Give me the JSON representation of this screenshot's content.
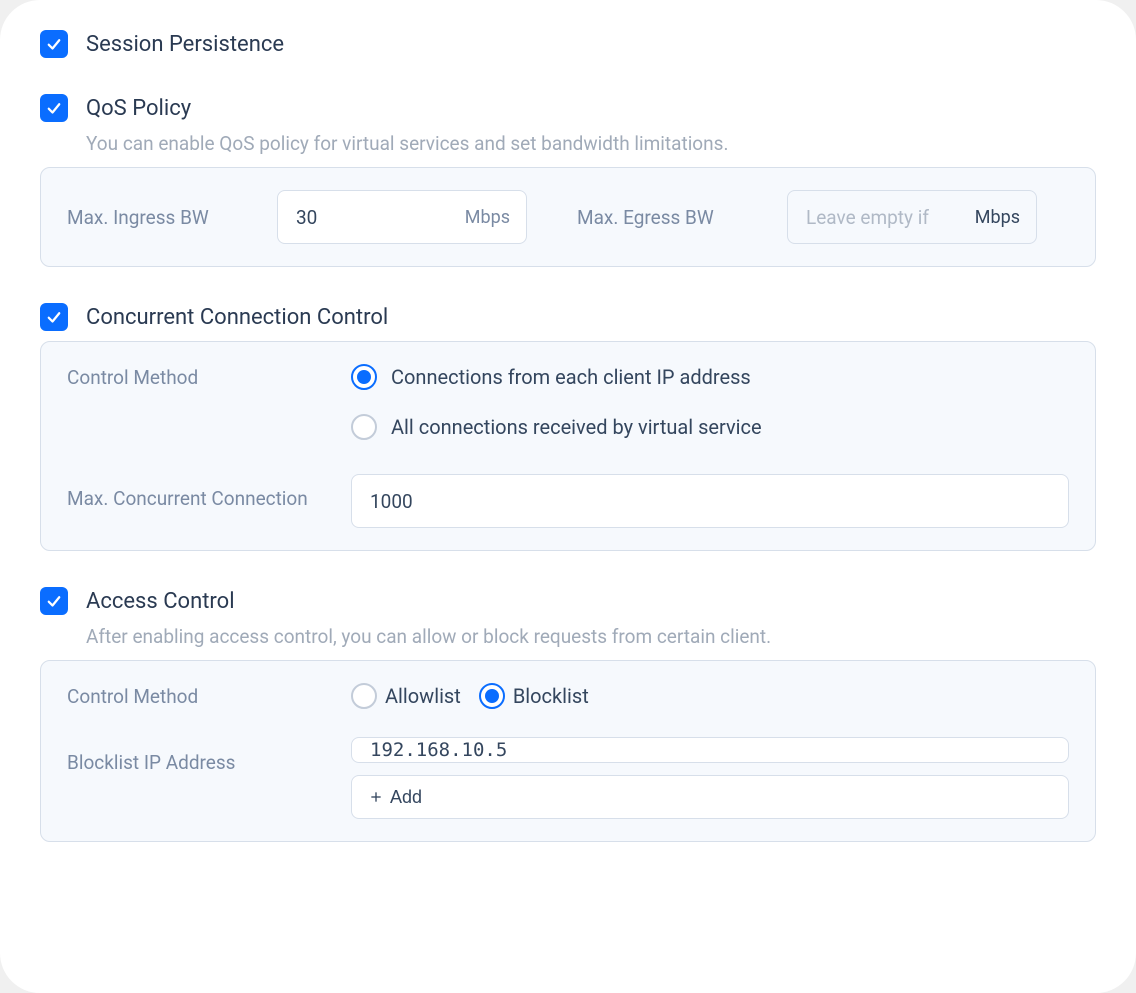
{
  "session": {
    "title": "Session Persistence"
  },
  "qos": {
    "title": "QoS Policy",
    "desc": "You can enable QoS policy for virtual services and set bandwidth limitations.",
    "ingress_label": "Max. Ingress BW",
    "ingress_value": "30",
    "ingress_unit": "Mbps",
    "egress_label": "Max. Egress BW",
    "egress_placeholder": "Leave empty if",
    "egress_unit": "Mbps"
  },
  "conn": {
    "title": "Concurrent Connection Control",
    "method_label": "Control Method",
    "option1": "Connections from each client IP address",
    "option2": "All connections received by virtual service",
    "max_label": "Max. Concurrent Connection",
    "max_value": "1000"
  },
  "access": {
    "title": "Access Control",
    "desc": "After enabling access control, you can allow or block requests from certain client.",
    "method_label": "Control Method",
    "allow_label": "Allowlist",
    "block_label": "Blocklist",
    "ip_label": "Blocklist IP Address",
    "ip_value": "192.168.10.5",
    "add_label": "Add"
  }
}
